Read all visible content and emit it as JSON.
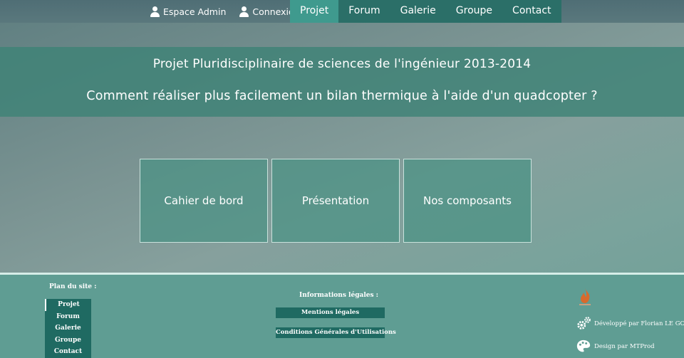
{
  "topbar": {
    "admin_links": [
      {
        "label": "Espace Admin",
        "icon": "user-icon"
      },
      {
        "label": "Connexion",
        "icon": "user-icon"
      }
    ],
    "nav": [
      {
        "label": "Projet",
        "active": true
      },
      {
        "label": "Forum"
      },
      {
        "label": "Galerie"
      },
      {
        "label": "Groupe"
      },
      {
        "label": "Contact"
      }
    ]
  },
  "banner": {
    "line1": "Projet Pluridisciplinaire de sciences de l'ingénieur 2013-2014",
    "line2": "Comment réaliser plus facilement un bilan thermique à l'aide d'un quadcopter ?"
  },
  "tiles": [
    {
      "label": "Cahier de bord"
    },
    {
      "label": "Présentation"
    },
    {
      "label": "Nos composants"
    }
  ],
  "footer": {
    "sitemap_title": "Plan du site :",
    "sitemap": [
      "Projet",
      "Forum",
      "Galerie",
      "Groupe",
      "Contact"
    ],
    "legal_title": "Informations légales :",
    "legal_links": [
      "Mentions légales",
      "Conditions Générales d'Utilisations"
    ],
    "credits": [
      {
        "label": "Développé par Florian LE GOFF",
        "icon": "gears-icon"
      },
      {
        "label": "Design par MTProd",
        "icon": "palette-icon"
      }
    ],
    "logo_icon": "flame-logo-icon"
  },
  "colors": {
    "nav_bg": "#2b6f68",
    "nav_active": "#3f9a8e",
    "banner_bg": "#3e8276",
    "footer_bg": "#5f9d93",
    "button_bg": "#1f6a62"
  }
}
